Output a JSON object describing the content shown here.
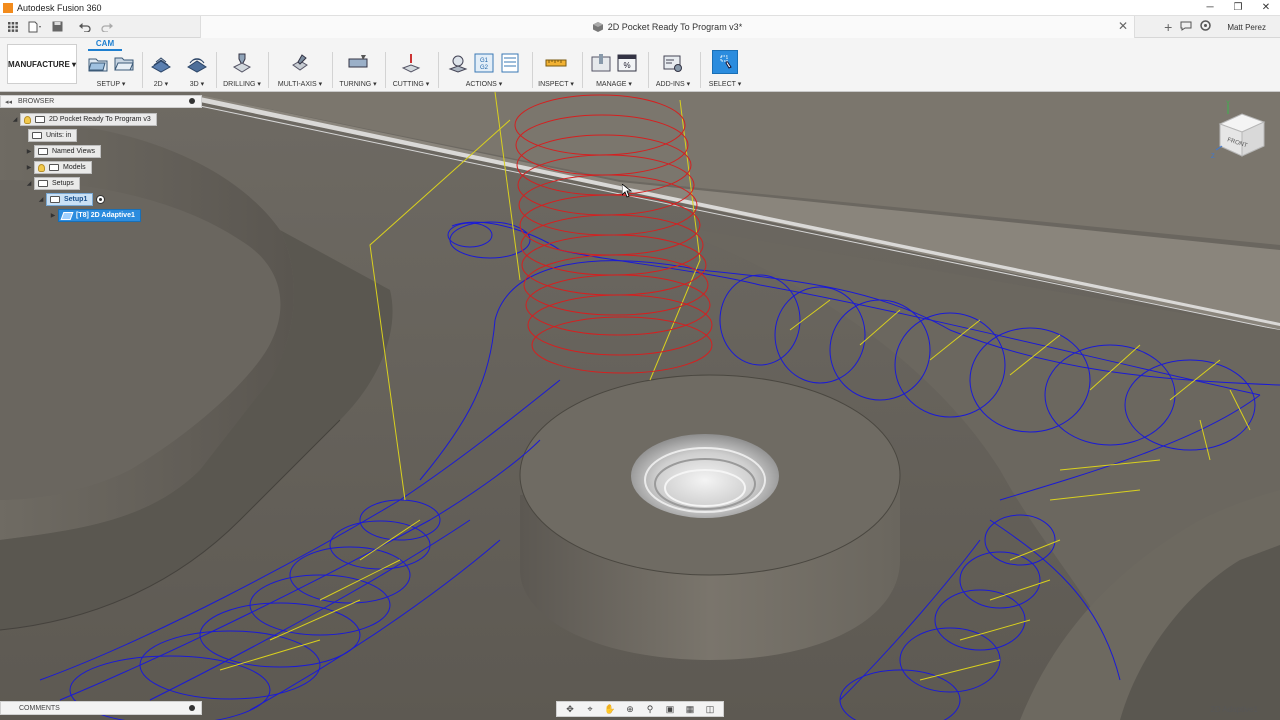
{
  "app": {
    "title": "Autodesk Fusion 360"
  },
  "window_controls": {
    "minimize": "─",
    "restore": "❐",
    "close": "✕"
  },
  "document": {
    "title": "2D Pocket Ready To Program v3*"
  },
  "user": {
    "name": "Matt Perez"
  },
  "workspace": {
    "label": "MANUFACTURE ▾",
    "tab": "CAM"
  },
  "ribbon": {
    "groups": [
      {
        "id": "setup",
        "label": "SETUP ▾"
      },
      {
        "id": "2d",
        "label": "2D ▾"
      },
      {
        "id": "3d",
        "label": "3D ▾"
      },
      {
        "id": "drilling",
        "label": "DRILLING ▾"
      },
      {
        "id": "multiaxis",
        "label": "MULTI-AXIS ▾"
      },
      {
        "id": "turning",
        "label": "TURNING ▾"
      },
      {
        "id": "cutting",
        "label": "CUTTING ▾"
      },
      {
        "id": "actions",
        "label": "ACTIONS ▾"
      },
      {
        "id": "inspect",
        "label": "INSPECT ▾"
      },
      {
        "id": "manage",
        "label": "MANAGE ▾"
      },
      {
        "id": "addins",
        "label": "ADD-INS ▾"
      },
      {
        "id": "select",
        "label": "SELECT ▾"
      }
    ],
    "g1g2_text": "G1 G2",
    "percent_text": "%"
  },
  "browser": {
    "title": "BROWSER",
    "collapse_glyph": "◂◂",
    "nodes": {
      "root": "2D Pocket Ready To Program v3",
      "units": "Units: in",
      "named_views": "Named Views",
      "models": "Models",
      "setups": "Setups",
      "setup1": "Setup1",
      "operation": "[T8] 2D Adaptive1"
    }
  },
  "comments": {
    "title": "COMMENTS"
  },
  "status": {
    "operation": "2D Adaptive1"
  },
  "viewcube": {
    "face": "FRONT",
    "x_axis": "X",
    "y_axis": "Y",
    "z_axis": "Z"
  },
  "colors": {
    "toolpath_blue": "#1a1ad6",
    "toolpath_yellow": "#d9d01e",
    "helix_red": "#d42020",
    "accent": "#1e7fd0",
    "selection": "#2b8cde"
  }
}
